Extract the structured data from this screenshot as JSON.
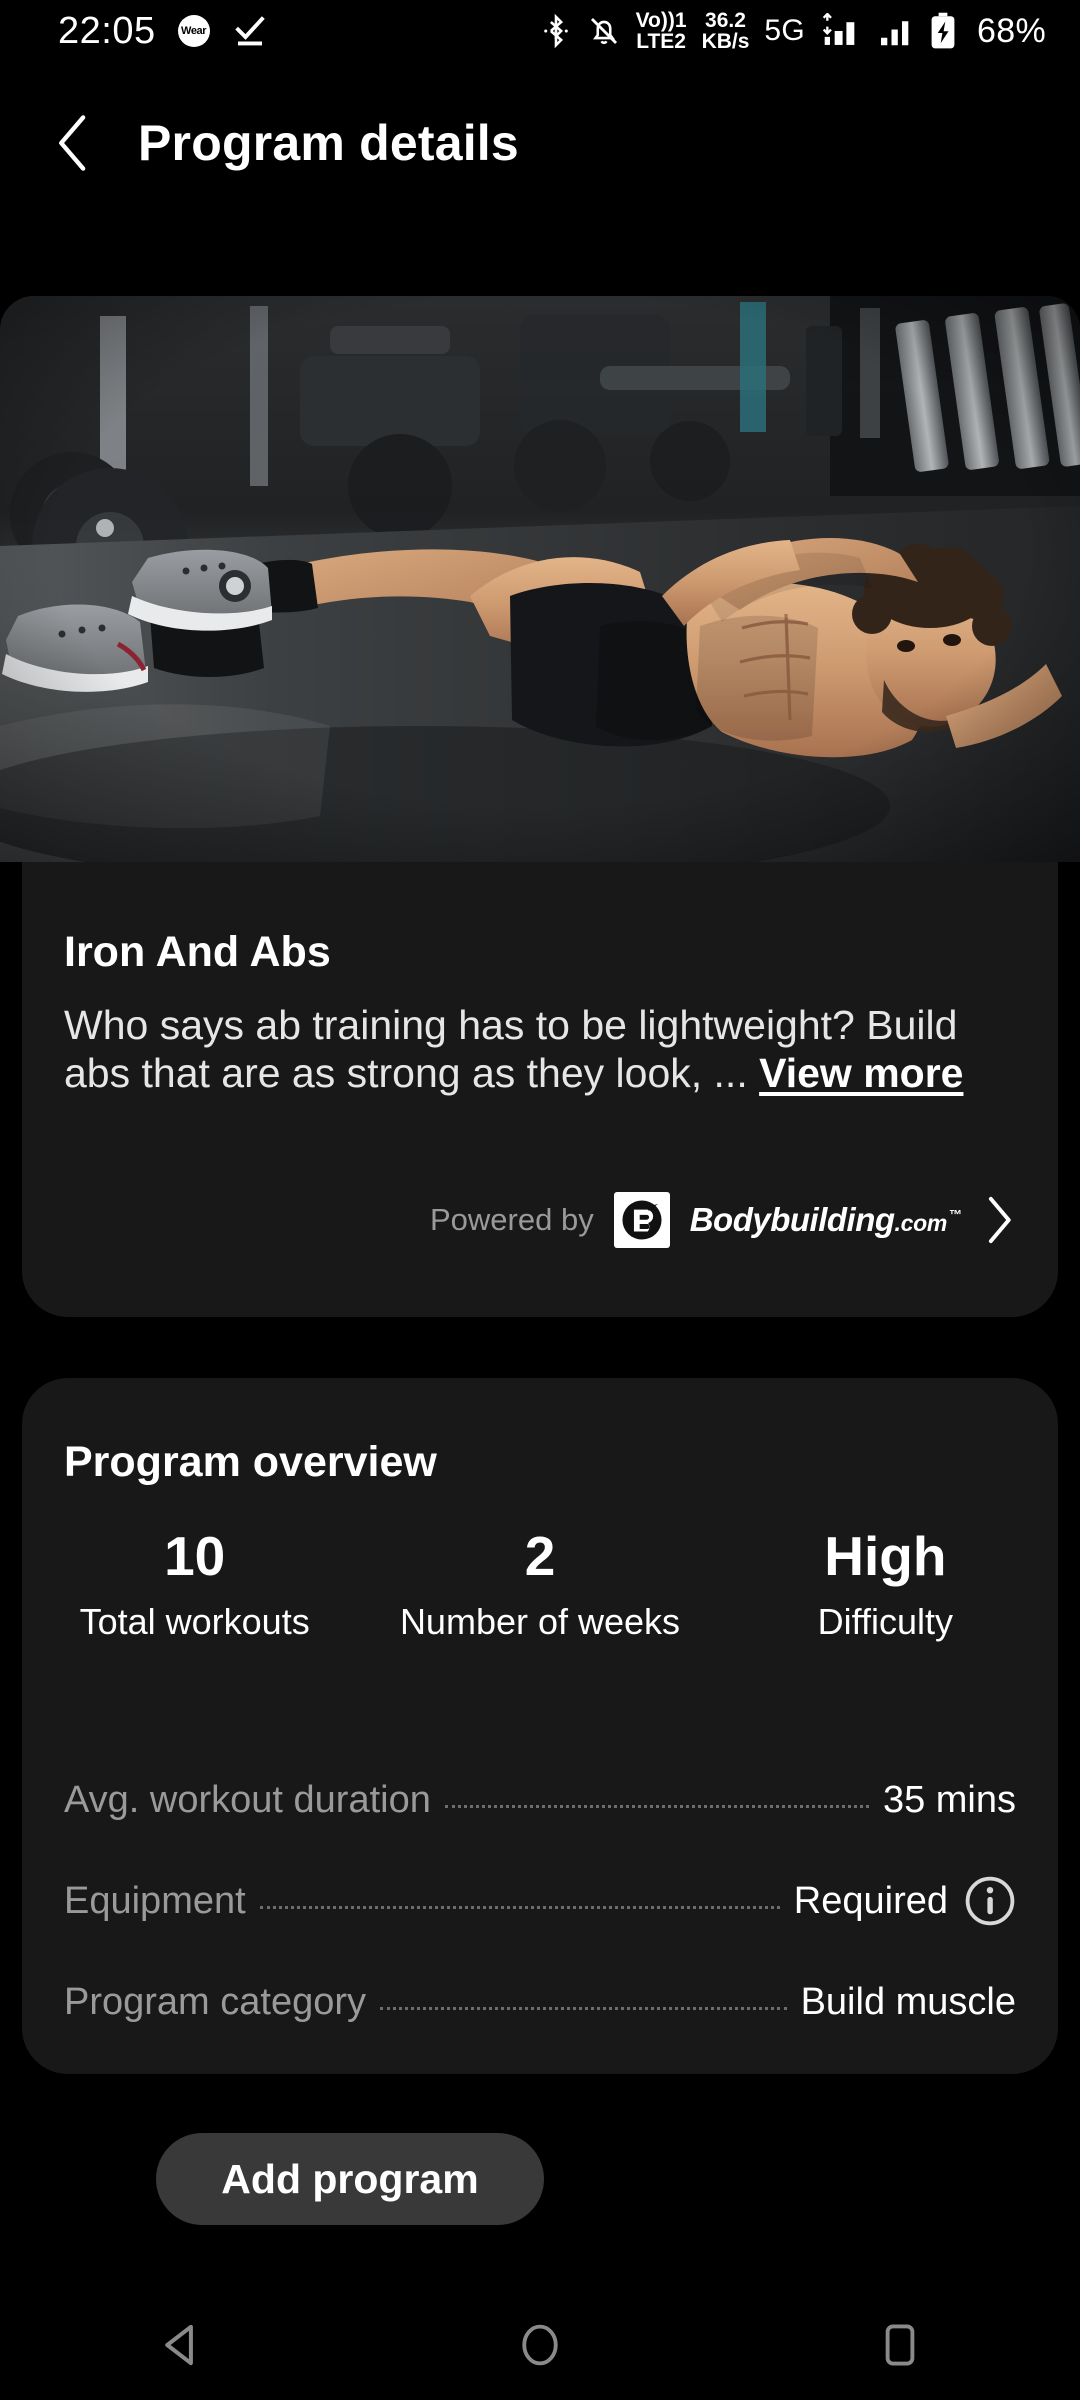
{
  "status_bar": {
    "time": "22:05",
    "wear_badge_label": "Wear",
    "network_speed_value": "36.2",
    "network_speed_unit": "KB/s",
    "volte_line1": "Vo))1",
    "volte_line2": "LTE2",
    "network_type": "5G",
    "battery_percent": "68%",
    "icons": [
      "wear-os-icon",
      "task-complete-icon",
      "bluetooth-icon",
      "mute-bell-icon",
      "volte-icon",
      "data-speed-icon",
      "signal-5g-icon",
      "signal-sim2-icon",
      "battery-charging-icon"
    ]
  },
  "header": {
    "title": "Program details",
    "back_icon": "chevron-left-icon"
  },
  "hero": {
    "alt": "Man performing bicycle crunch abs exercise on gym floor",
    "icon": "program-hero-image"
  },
  "program": {
    "title": "Iron And Abs",
    "description": "Who says ab training has to be lightweight? Build abs that are as strong as they look, ... ",
    "view_more_label": "View more",
    "powered_by_label": "Powered by",
    "brand_logo_letter": "B",
    "brand_name_main": "Bodybuilding",
    "brand_name_suffix": ".com",
    "brand_trademark": "™",
    "chevron_icon": "chevron-right-icon"
  },
  "overview": {
    "section_title": "Program overview",
    "stats": [
      {
        "value": "10",
        "label": "Total workouts"
      },
      {
        "value": "2",
        "label": "Number of weeks"
      },
      {
        "value": "High",
        "label": "Difficulty"
      }
    ],
    "details": [
      {
        "label": "Avg. workout duration",
        "value": "35 mins",
        "info": false
      },
      {
        "label": "Equipment",
        "value": "Required",
        "info": true,
        "info_icon": "info-circle-icon"
      },
      {
        "label": "Program category",
        "value": "Build muscle",
        "info": false
      }
    ]
  },
  "cta": {
    "label": "Add program"
  },
  "nav_bar": {
    "back_icon": "nav-back-triangle-icon",
    "home_icon": "nav-home-circle-icon",
    "recents_icon": "nav-recents-square-icon"
  },
  "colors": {
    "background": "#000000",
    "card": "#181818",
    "cta": "#393939",
    "muted_text": "#9a9a9a",
    "primary_text": "#ffffff",
    "nav_icon": "#8a8a8a"
  }
}
